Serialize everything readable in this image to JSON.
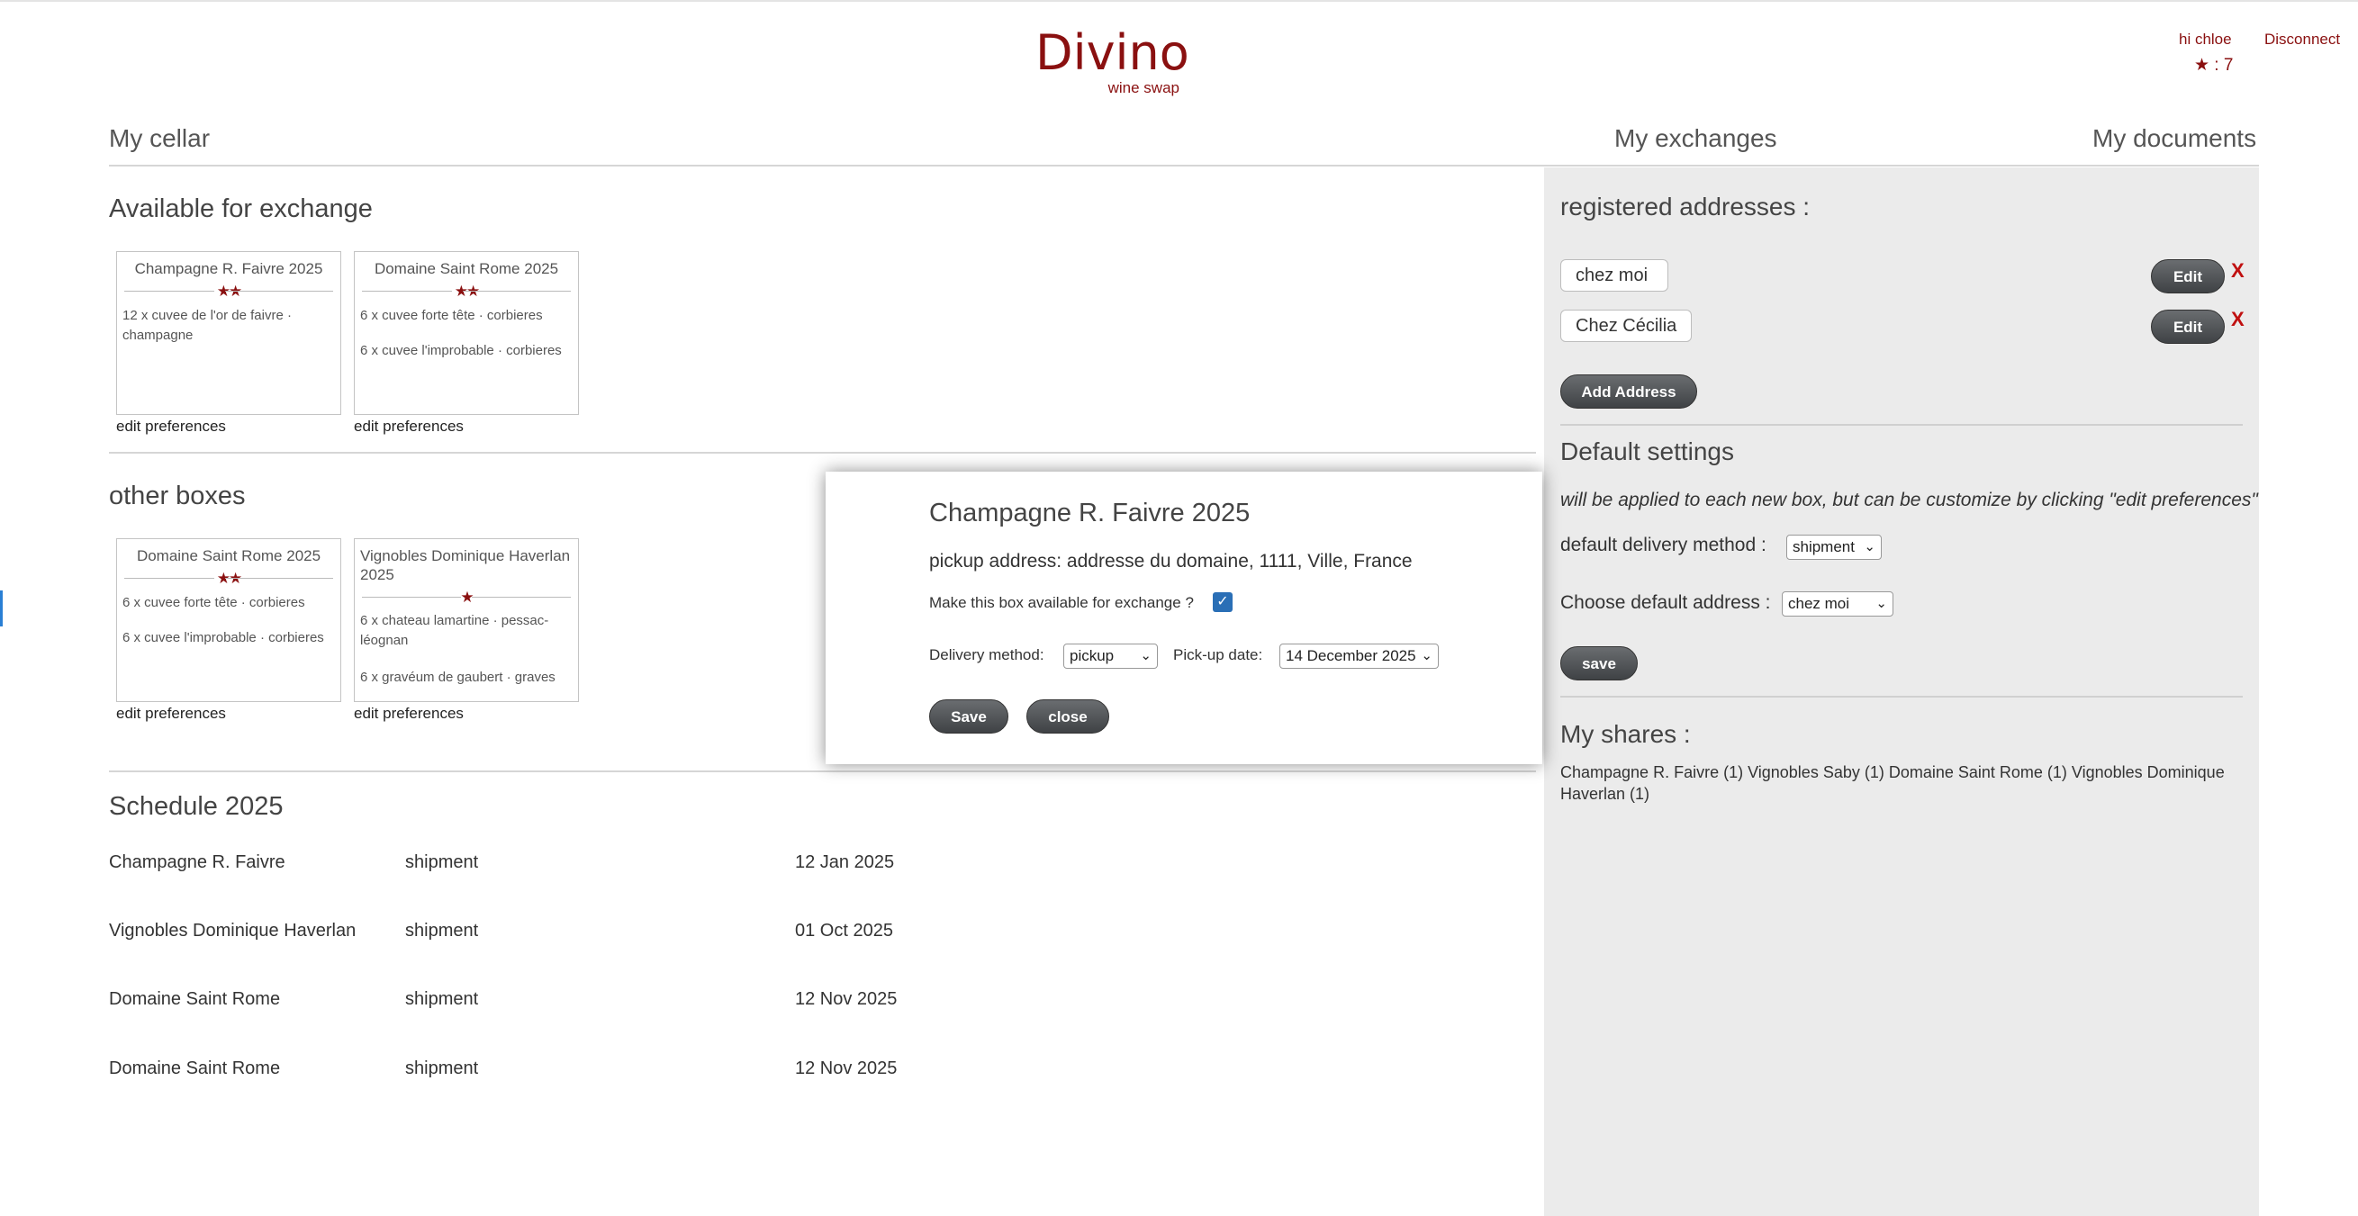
{
  "header": {
    "brand_title": "Divino",
    "brand_subtitle": "wine swap",
    "greeting": "hi chloe",
    "disconnect": "Disconnect",
    "stars_label": "★ : 7"
  },
  "nav": {
    "my_cellar": "My cellar",
    "my_exchanges": "My exchanges",
    "my_documents": "My documents"
  },
  "available": {
    "heading": "Available for exchange",
    "cards": [
      {
        "title": "Champagne R. Faivre 2025",
        "stars": "★★",
        "lines": [
          "12 x cuvee de l'or de faivre  · champagne"
        ],
        "edit": "edit preferences"
      },
      {
        "title": "Domaine Saint Rome 2025",
        "stars": "★★",
        "lines": [
          "6 x cuvee forte tête  · corbieres",
          "6 x cuvee l'improbable  · corbieres"
        ],
        "edit": "edit preferences"
      }
    ]
  },
  "other": {
    "heading": "other boxes",
    "cards": [
      {
        "title": "Domaine Saint Rome 2025",
        "stars": "★★",
        "lines": [
          "6 x cuvee forte tête  · corbieres",
          "6 x cuvee l'improbable  · corbieres"
        ],
        "edit": "edit preferences"
      },
      {
        "title": "Vignobles Dominique Haverlan 2025",
        "stars": "★",
        "lines": [
          "6 x chateau lamartine  · pessac-léognan",
          "6 x gravéum de gaubert  · graves"
        ],
        "edit": "edit preferences"
      }
    ]
  },
  "schedule": {
    "heading": "Schedule 2025",
    "rows": [
      {
        "name": "Champagne R. Faivre",
        "method": "shipment",
        "date": "12 Jan 2025"
      },
      {
        "name": "Vignobles Dominique Haverlan",
        "method": "shipment",
        "date": "01 Oct 2025"
      },
      {
        "name": "Domaine Saint Rome",
        "method": "shipment",
        "date": "12 Nov 2025"
      },
      {
        "name": "Domaine Saint Rome",
        "method": "shipment",
        "date": "12 Nov 2025"
      }
    ]
  },
  "sidebar": {
    "addresses_heading": "registered addresses :",
    "addresses": [
      {
        "name": "chez moi",
        "edit": "Edit",
        "remove": "X"
      },
      {
        "name": "Chez Cécilia",
        "edit": "Edit",
        "remove": "X"
      }
    ],
    "add_address": "Add Address",
    "defaults_heading": "Default settings",
    "defaults_note": "will be applied to each new box, but can be customize by clicking \"edit preferences\"",
    "delivery_label": "default delivery method :",
    "delivery_value": "shipment",
    "address_label": "Choose default address :",
    "address_value": "chez moi",
    "save": "save",
    "shares_heading": "My shares :",
    "shares_line1": "Champagne R. Faivre (1) Vignobles Saby (1) Domaine Saint Rome (1) Vignobles Dominique",
    "shares_line2": "Haverlan (1)"
  },
  "modal": {
    "title": "Champagne R. Faivre 2025",
    "pickup_address": "pickup address: addresse du domaine, 1111, Ville, France",
    "available_label": "Make this box available for exchange ?",
    "available_checked": true,
    "delivery_label": "Delivery method:",
    "delivery_value": "pickup",
    "pickup_date_label": "Pick-up date:",
    "pickup_date_value": "14 December 2025",
    "save": "Save",
    "close": "close"
  },
  "colors": {
    "brand": "#8a1010",
    "panel": "#ebebeb",
    "button": "#4a4d50",
    "checkbox": "#2a6fb6"
  }
}
